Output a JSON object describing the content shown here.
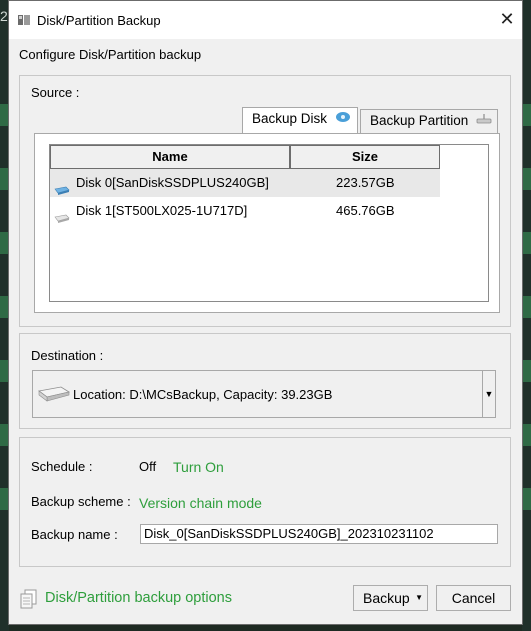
{
  "background": {
    "edge_char": "2"
  },
  "window": {
    "title": "Disk/Partition Backup",
    "subtitle": "Configure Disk/Partition backup"
  },
  "source": {
    "label": "Source :",
    "tabs": [
      {
        "label": "Backup Disk",
        "active": true
      },
      {
        "label": "Backup Partition",
        "active": false
      }
    ],
    "columns": [
      "Name",
      "Size"
    ],
    "disks": [
      {
        "name": "Disk 0[SanDiskSSDPLUS240GB]",
        "size": "223.57GB",
        "selected": true
      },
      {
        "name": "Disk 1[ST500LX025-1U717D]",
        "size": "465.76GB",
        "selected": false
      }
    ]
  },
  "destination": {
    "label": "Destination :",
    "location": "Location: D:\\MCsBackup, Capacity: 39.23GB"
  },
  "schedule": {
    "label": "Schedule :",
    "value": "Off",
    "link": "Turn On"
  },
  "scheme": {
    "label": "Backup scheme :",
    "value": "Version chain mode"
  },
  "backup_name": {
    "label": "Backup name :",
    "value": "Disk_0[SanDiskSSDPLUS240GB]_202310231102"
  },
  "options_link": "Disk/Partition backup options",
  "buttons": {
    "backup": "Backup",
    "cancel": "Cancel"
  },
  "colors": {
    "accent_green": "#2e9e3c"
  }
}
